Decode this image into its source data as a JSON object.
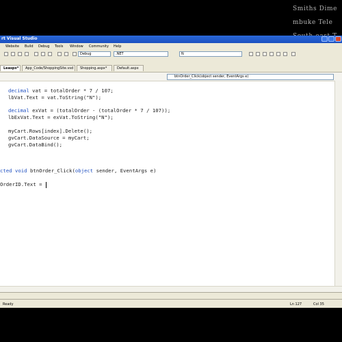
{
  "overlay": {
    "line1": "Smiths Dime",
    "line2": "mbuke Tele",
    "line3": "South-east T"
  },
  "window": {
    "title": "rt Visual Studio"
  },
  "menu": [
    "Website",
    "Build",
    "Debug",
    "Tools",
    "Window",
    "Community",
    "Help"
  ],
  "toolbar": {
    "config": "Debug",
    "platform": ".NET",
    "find": "N"
  },
  "tabs": [
    {
      "label": "Leaspx*",
      "active": true
    },
    {
      "label": "App_Code/ShoppingSite.vsd",
      "active": false
    },
    {
      "label": "Shopping.aspx*",
      "active": false
    },
    {
      "label": "Default.aspx",
      "active": false
    }
  ],
  "navbar": {
    "member": "btnOrder_Click(object sender, EventArgs e)"
  },
  "code": {
    "l1_kw": "decimal",
    "l1_rest": " vat = totalOrder * 7 / 107;",
    "l2": "lbVat.Text = vat.ToString(\"N\");",
    "l4_kw": "decimal",
    "l4_rest": " exVat = (totalOrder - (totalOrder * 7 / 107));",
    "l5": "lbExVat.Text = exVat.ToString(\"N\");",
    "l7": "myCart.Rows[index].Delete();",
    "l8": "gvCart.DataSource = myCart;",
    "l9": "gvCart.DataBind();",
    "l12_kw": "cted void",
    "l12_rest": " btnOrder_Click(",
    "l12_kw2": "object",
    "l12_rest2": " sender, EventArgs e)",
    "l14": "OrderID.Text = "
  },
  "status": {
    "left": "Ready",
    "ln": "Ln 127",
    "col": "Col 35"
  }
}
